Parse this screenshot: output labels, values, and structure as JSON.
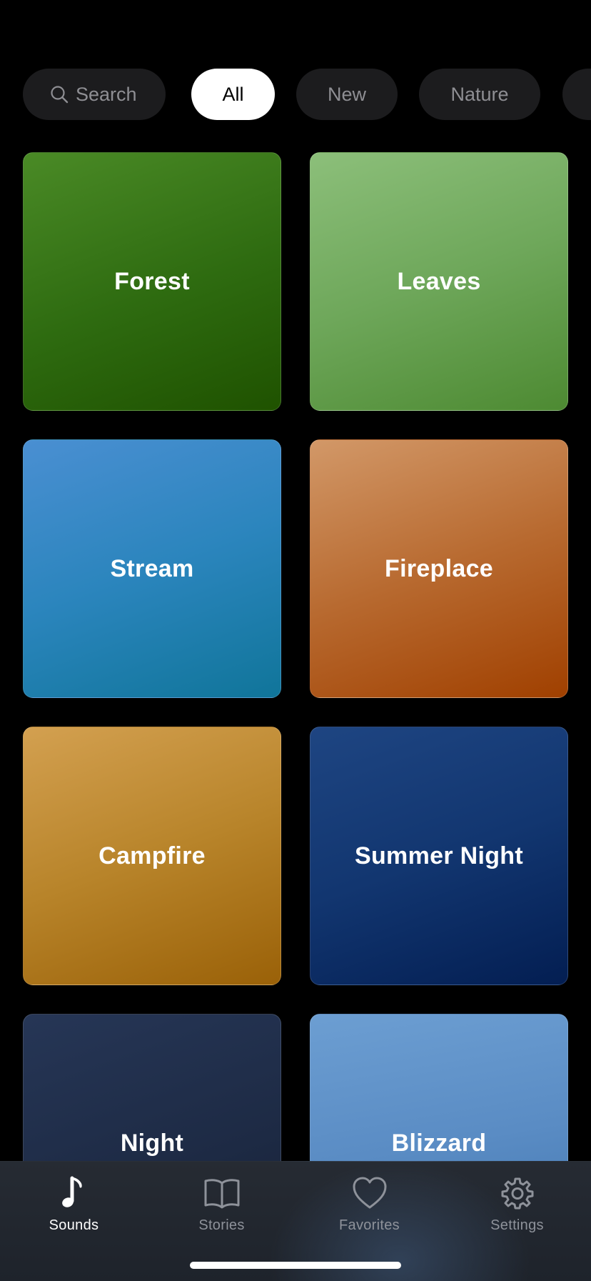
{
  "filters": {
    "search_label": "Search",
    "chips": [
      {
        "label": "All",
        "selected": true
      },
      {
        "label": "New",
        "selected": false
      },
      {
        "label": "Nature",
        "selected": false
      }
    ]
  },
  "sounds": [
    {
      "label": "Forest",
      "color": "#2e6b10"
    },
    {
      "label": "Leaves",
      "color": "#6ea75a"
    },
    {
      "label": "Stream",
      "color": "#2b85bd"
    },
    {
      "label": "Fireplace",
      "color": "#b86a30"
    },
    {
      "label": "Campfire",
      "color": "#b8842a"
    },
    {
      "label": "Summer Night",
      "color": "#123670"
    },
    {
      "label": "Night",
      "color": "#1d2a44"
    },
    {
      "label": "Blizzard",
      "color": "#5a8cc4"
    }
  ],
  "tabbar": {
    "tabs": [
      {
        "label": "Sounds",
        "icon": "music-note-icon",
        "active": true
      },
      {
        "label": "Stories",
        "icon": "book-icon",
        "active": false
      },
      {
        "label": "Favorites",
        "icon": "heart-icon",
        "active": false
      },
      {
        "label": "Settings",
        "icon": "gear-icon",
        "active": false
      }
    ]
  }
}
